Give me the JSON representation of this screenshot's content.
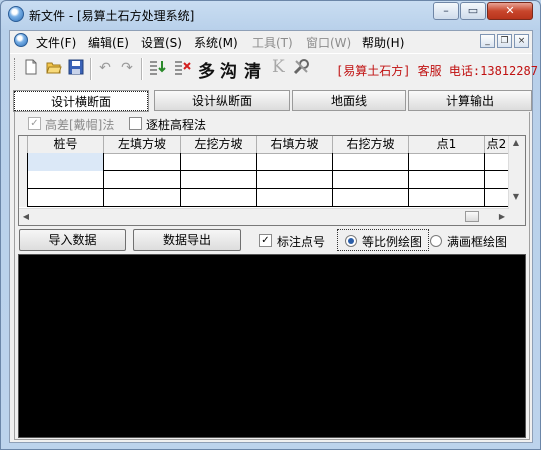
{
  "window": {
    "title": "新文件 - [易算土石方处理系统]",
    "minimize": "–",
    "maximize": "▭",
    "close": "✕"
  },
  "menubar": {
    "items": [
      {
        "label": "文件(F)",
        "enabled": true
      },
      {
        "label": "编辑(E)",
        "enabled": true
      },
      {
        "label": "设置(S)",
        "enabled": true
      },
      {
        "label": "系统(M)",
        "enabled": true
      },
      {
        "label": "工具(T)",
        "enabled": false
      },
      {
        "label": "窗口(W)",
        "enabled": false
      },
      {
        "label": "帮助(H)",
        "enabled": true
      }
    ],
    "mdi": {
      "minimize": "_",
      "restore": "❐",
      "close": "×"
    }
  },
  "toolbar": {
    "text_tools": [
      "多",
      "沟",
      "清",
      "K"
    ],
    "info": "[易算土石方] 客服 电话:13812287"
  },
  "tabs": [
    {
      "label": "设计横断面",
      "active": true
    },
    {
      "label": "设计纵断面",
      "active": false
    },
    {
      "label": "地面线",
      "active": false
    },
    {
      "label": "计算输出",
      "active": false
    }
  ],
  "options": {
    "height_diff_label": "高差[戴帽]法",
    "height_diff_checked": true,
    "per_pile_label": "逐桩高程法",
    "per_pile_checked": false
  },
  "grid": {
    "columns": [
      "桩号",
      "左填方坡",
      "左挖方坡",
      "右填方坡",
      "右挖方坡",
      "点1",
      "点2"
    ],
    "rows": [
      [
        "",
        "",
        "",
        "",
        "",
        "",
        ""
      ],
      [
        "",
        "",
        "",
        "",
        "",
        "",
        ""
      ],
      [
        "",
        "",
        "",
        "",
        "",
        "",
        ""
      ]
    ]
  },
  "actions": {
    "import_label": "导入数据",
    "export_label": "数据导出",
    "mark_points_label": "标注点号",
    "mark_points_checked": true,
    "scale_draw_label": "等比例绘图",
    "scale_draw_selected": true,
    "fill_draw_label": "满画框绘图",
    "fill_draw_selected": false
  },
  "colors": {
    "canvas": "#000000",
    "selected_cell": "#dbe8f7",
    "info_text": "#c01010"
  }
}
